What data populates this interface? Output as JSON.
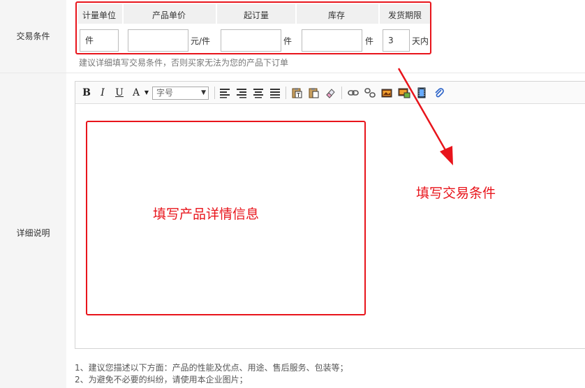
{
  "labels": {
    "trade_terms": "交易条件",
    "details": "详细说明"
  },
  "trade_table": {
    "headers": [
      "计量单位",
      "产品单价",
      "起订量",
      "库存",
      "发货期限"
    ],
    "unit_value": "件",
    "price_value": "",
    "price_suffix": "元/件",
    "min_order_value": "",
    "min_order_suffix": "件",
    "stock_value": "",
    "stock_suffix": "件",
    "ship_days_value": "3",
    "ship_days_suffix": "天内"
  },
  "hint": "建议详细填写交易条件，否则买家无法为您的产品下订单",
  "editor": {
    "toolbar": {
      "bold": "B",
      "italic": "I",
      "underline": "U",
      "font_color": "A",
      "font_size_placeholder": "字号"
    }
  },
  "annotations": {
    "fill_trade_terms": "填写交易条件",
    "fill_product_details": "填写产品详情信息",
    "color": "#e8141b"
  },
  "tips": [
    "1、建议您描述以下方面：产品的性能及优点、用途、售后服务、包装等；",
    "2、为避免不必要的纠纷，请使用本企业图片；"
  ]
}
